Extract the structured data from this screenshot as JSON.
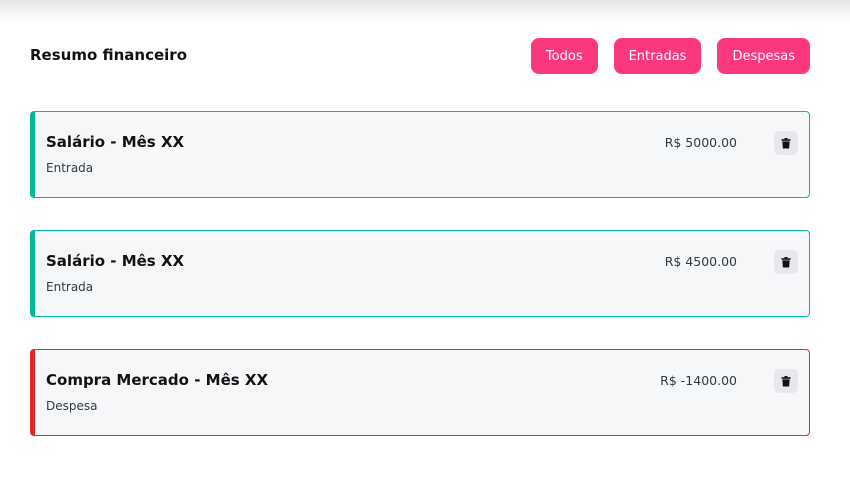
{
  "header": {
    "title": "Resumo financeiro"
  },
  "filters": [
    {
      "label": "Todos"
    },
    {
      "label": "Entradas"
    },
    {
      "label": "Despesas"
    }
  ],
  "colors": {
    "primary_pink": "#fd377e",
    "entrada_accent": "#03b898",
    "despesa_accent": "#e02828"
  },
  "transactions": [
    {
      "title": "Salário - Mês XX",
      "type": "Entrada",
      "value": "R$ 5000.00",
      "kind": "entrada",
      "icon": "trash-icon"
    },
    {
      "title": "Salário - Mês XX",
      "type": "Entrada",
      "value": "R$ 4500.00",
      "kind": "entrada",
      "icon": "trash-icon"
    },
    {
      "title": "Compra Mercado - Mês XX",
      "type": "Despesa",
      "value": "R$ -1400.00",
      "kind": "despesa",
      "icon": "trash-icon"
    }
  ]
}
